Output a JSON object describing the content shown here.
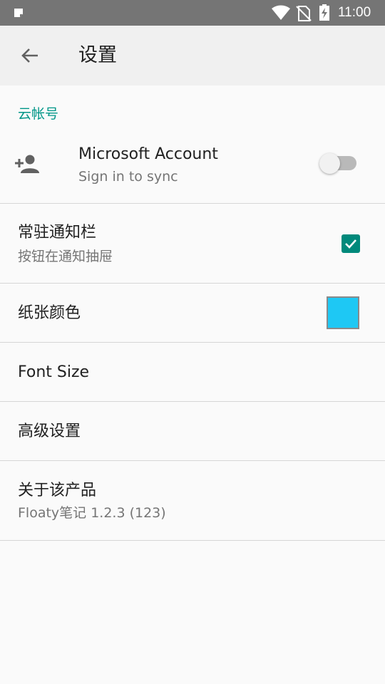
{
  "status_bar": {
    "time": "11:00",
    "icons": [
      "note-icon",
      "wifi-icon",
      "no-sim-icon",
      "battery-charging-icon"
    ]
  },
  "toolbar": {
    "back_icon": "arrow-left-icon",
    "title": "设置"
  },
  "cloud_account": {
    "section_title": "云帐号",
    "icon": "person-add-icon",
    "title": "Microsoft Account",
    "summary": "Sign in to sync",
    "switch_on": false
  },
  "settings": {
    "notification": {
      "title": "常驻通知栏",
      "summary": "按钮在通知抽屉",
      "checked": true
    },
    "paper_color": {
      "title": "纸张颜色",
      "color": "#1ec8f4"
    },
    "font_size": {
      "title": "Font Size"
    },
    "advanced": {
      "title": "高级设置"
    },
    "about": {
      "title": "关于该产品",
      "summary": "Floaty笔记 1.2.3 (123)"
    }
  },
  "colors": {
    "accent": "#009688",
    "checkbox": "#00897b",
    "status_bar": "#757575",
    "toolbar": "#f0f0f0",
    "background": "#fafafa"
  }
}
